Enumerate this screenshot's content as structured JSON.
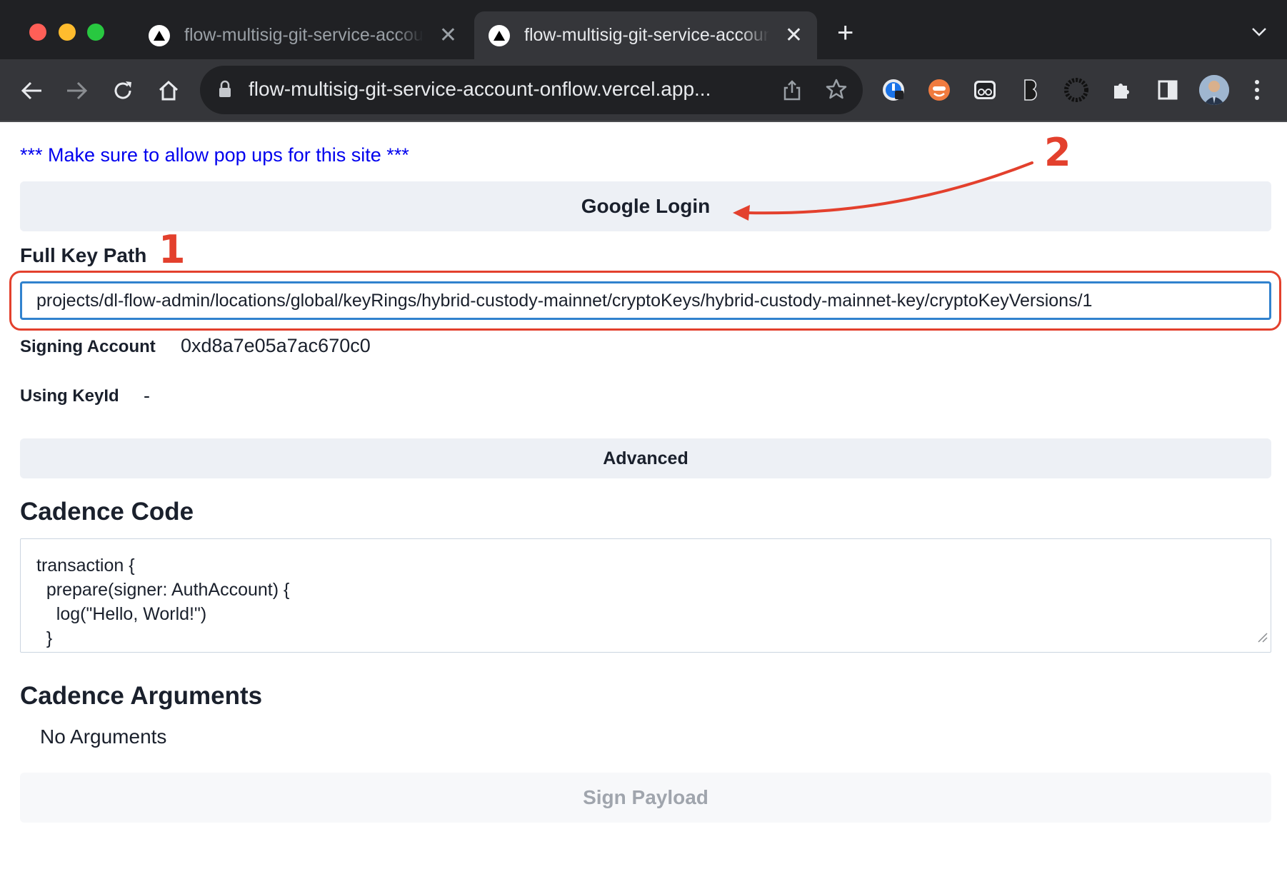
{
  "browser": {
    "tabs": [
      {
        "title": "flow-multisig-git-service-account-onflow",
        "close": "✕"
      },
      {
        "title": "flow-multisig-git-service-account-onflow",
        "close": "✕"
      }
    ],
    "new_tab": "+",
    "url": "flow-multisig-git-service-account-onflow.vercel.app..."
  },
  "page": {
    "popup_notice": "*** Make sure to allow pop ups for this site ***",
    "google_login_label": "Google Login",
    "full_key_path_label": "Full Key Path",
    "full_key_path_value": "projects/dl-flow-admin/locations/global/keyRings/hybrid-custody-mainnet/cryptoKeys/hybrid-custody-mainnet-key/cryptoKeyVersions/1",
    "signing_account_label": "Signing Account",
    "signing_account_value": "0xd8a7e05a7ac670c0",
    "using_keyid_label": "Using KeyId",
    "using_keyid_value": "-",
    "advanced_label": "Advanced",
    "cadence_code_heading": "Cadence Code",
    "cadence_code": "transaction {\n  prepare(signer: AuthAccount) {\n    log(\"Hello, World!\")\n  }",
    "cadence_arguments_heading": "Cadence Arguments",
    "no_arguments": "No Arguments",
    "sign_payload_label": "Sign Payload"
  },
  "annotations": {
    "marker_1": "1",
    "marker_2": "2",
    "color": "#e3402d"
  },
  "colors": {
    "link_blue": "#0000ee",
    "focus_blue": "#3182ce",
    "button_gray": "#edf0f5"
  }
}
